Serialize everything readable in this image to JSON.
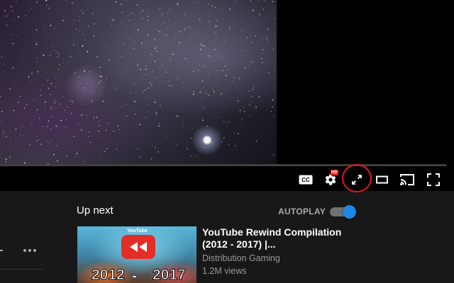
{
  "player": {
    "controls": {
      "cc_label": "CC",
      "hd_badge": "HD",
      "icons": [
        "closed-captions-icon",
        "settings-gear-icon",
        "miniplayer-expand-icon",
        "theater-mode-icon",
        "cast-icon",
        "fullscreen-icon"
      ]
    },
    "highlight_color": "#e0191f"
  },
  "sidebar": {
    "up_next_label": "Up next",
    "autoplay_label": "AUTOPLAY",
    "autoplay_on": true,
    "accent_color": "#1e88e5",
    "videos": [
      {
        "title": "YouTube Rewind Compilation (2012 - 2017) |...",
        "channel": "Distribution Gaming",
        "views": "1.2M views",
        "thumbnail": {
          "brand": "YouTube",
          "year_left": "2012",
          "year_right": "2017"
        }
      }
    ]
  }
}
